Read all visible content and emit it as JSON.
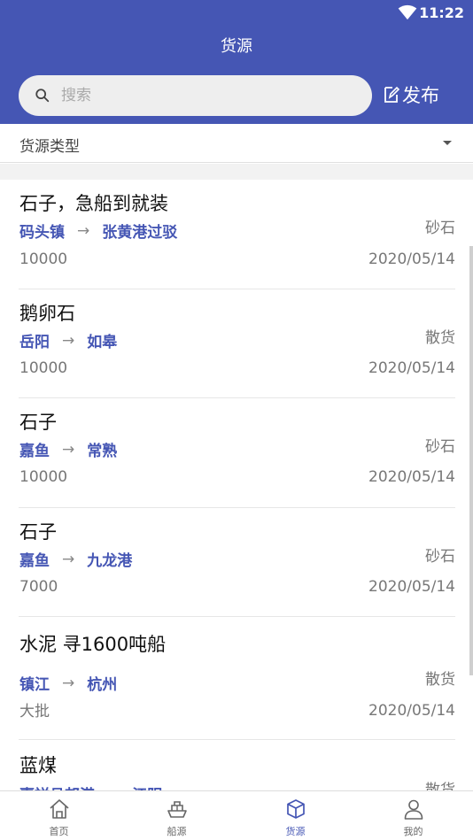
{
  "status_bar": {
    "time": "11:22"
  },
  "header": {
    "title": "货源"
  },
  "search": {
    "placeholder": "搜索"
  },
  "publish": {
    "label": "发布"
  },
  "filter": {
    "label": "货源类型"
  },
  "listings": [
    {
      "title": "石子，急船到就装",
      "from": "码头镇",
      "to": "张黄港过驳",
      "type": "砂石",
      "qty": "10000",
      "date": "2020/05/14"
    },
    {
      "title": "鹅卵石",
      "from": "岳阳",
      "to": "如皋",
      "type": "散货",
      "qty": "10000",
      "date": "2020/05/14"
    },
    {
      "title": "石子",
      "from": "嘉鱼",
      "to": "常熟",
      "type": "砂石",
      "qty": "10000",
      "date": "2020/05/14"
    },
    {
      "title": "石子",
      "from": "嘉鱼",
      "to": "九龙港",
      "type": "砂石",
      "qty": "7000",
      "date": "2020/05/14"
    },
    {
      "title": "水泥 寻1600吨船",
      "from": "镇江",
      "to": "杭州",
      "type": "散货",
      "qty": "大批",
      "date": "2020/05/14"
    },
    {
      "title": "蓝煤",
      "from": "嘉祥县邦港",
      "to": "江阴",
      "type": "散货",
      "qty": "",
      "date": ""
    }
  ],
  "route_arrow": "→",
  "tabs": [
    {
      "label": "首页",
      "icon": "home-icon"
    },
    {
      "label": "船源",
      "icon": "ship-icon"
    },
    {
      "label": "货源",
      "icon": "box-icon"
    },
    {
      "label": "我的",
      "icon": "user-icon"
    }
  ],
  "colors": {
    "primary": "#4556b4",
    "route_text": "#4556b4",
    "muted_text": "#777777"
  }
}
